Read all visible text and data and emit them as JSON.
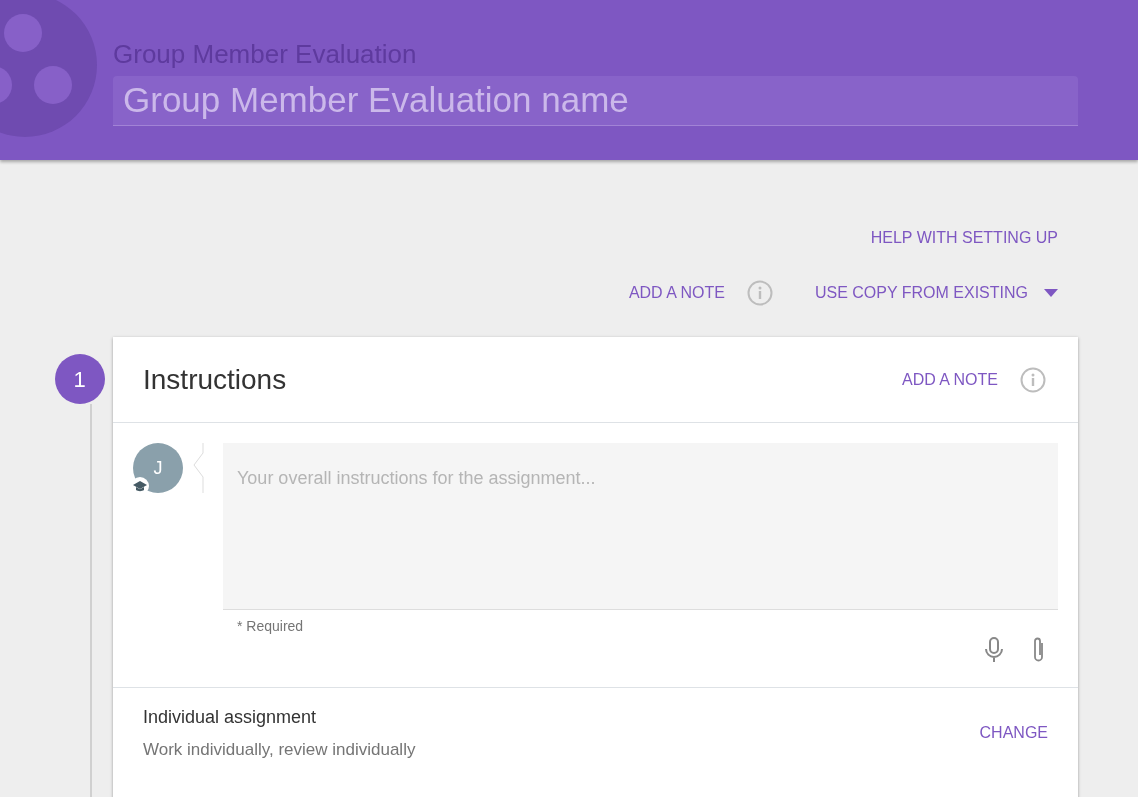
{
  "header": {
    "title": "Group Member Evaluation",
    "name_field": {
      "placeholder": "Group Member Evaluation name"
    }
  },
  "actions": {
    "help": "HELP WITH SETTING UP",
    "add_note": "ADD A NOTE",
    "use_copy": "USE COPY FROM EXISTING"
  },
  "step": {
    "number": "1",
    "card": {
      "title": "Instructions",
      "add_note": "ADD A NOTE",
      "avatar": {
        "initial": "J"
      },
      "instructions_field": {
        "placeholder": "Your overall instructions for the assignment..."
      },
      "required_hint": "* Required",
      "assignment": {
        "title": "Individual assignment",
        "description": "Work individually, review individually",
        "change": "CHANGE"
      }
    }
  }
}
